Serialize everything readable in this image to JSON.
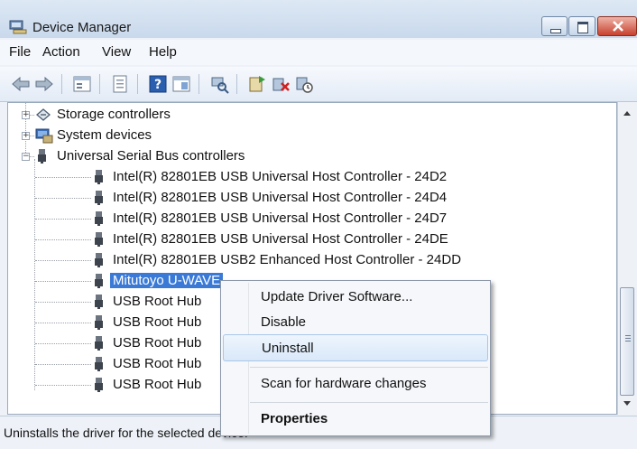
{
  "window": {
    "title": "Device Manager"
  },
  "menu": [
    "File",
    "Action",
    "View",
    "Help"
  ],
  "toolbar": {
    "icons": [
      "back-icon",
      "forward-icon",
      "show-hide-tree-icon",
      "properties-icon",
      "help-icon",
      "view-icon",
      "scan-hardware-icon",
      "update-driver-icon",
      "uninstall-icon",
      "disable-icon"
    ]
  },
  "tree": {
    "categories": [
      {
        "label": "Storage controllers",
        "icon": "storage-controller-icon",
        "expanded": false
      },
      {
        "label": "System devices",
        "icon": "system-devices-icon",
        "expanded": false
      },
      {
        "label": "Universal Serial Bus controllers",
        "icon": "usb-plug-icon",
        "expanded": true
      }
    ],
    "usb_devices": [
      "Intel(R) 82801EB USB Universal Host Controller - 24D2",
      "Intel(R) 82801EB USB Universal Host Controller - 24D4",
      "Intel(R) 82801EB USB Universal Host Controller - 24D7",
      "Intel(R) 82801EB USB Universal Host Controller - 24DE",
      "Intel(R) 82801EB USB2 Enhanced Host Controller - 24DD",
      "Mitutoyo U-WAVE",
      "USB Root Hub",
      "USB Root Hub",
      "USB Root Hub",
      "USB Root Hub",
      "USB Root Hub"
    ],
    "selected_device": "Mitutoyo U-WAVE"
  },
  "context_menu": {
    "items": [
      "Update Driver Software...",
      "Disable",
      "Uninstall",
      "Scan for hardware changes",
      "Properties"
    ],
    "highlighted": "Uninstall",
    "default_item": "Properties"
  },
  "status_bar": {
    "text": "Uninstalls the driver for the selected device."
  },
  "colors": {
    "selection": "#3a7ad6",
    "title_bar": "#c9d9ec",
    "close_button": "#c8402d"
  }
}
